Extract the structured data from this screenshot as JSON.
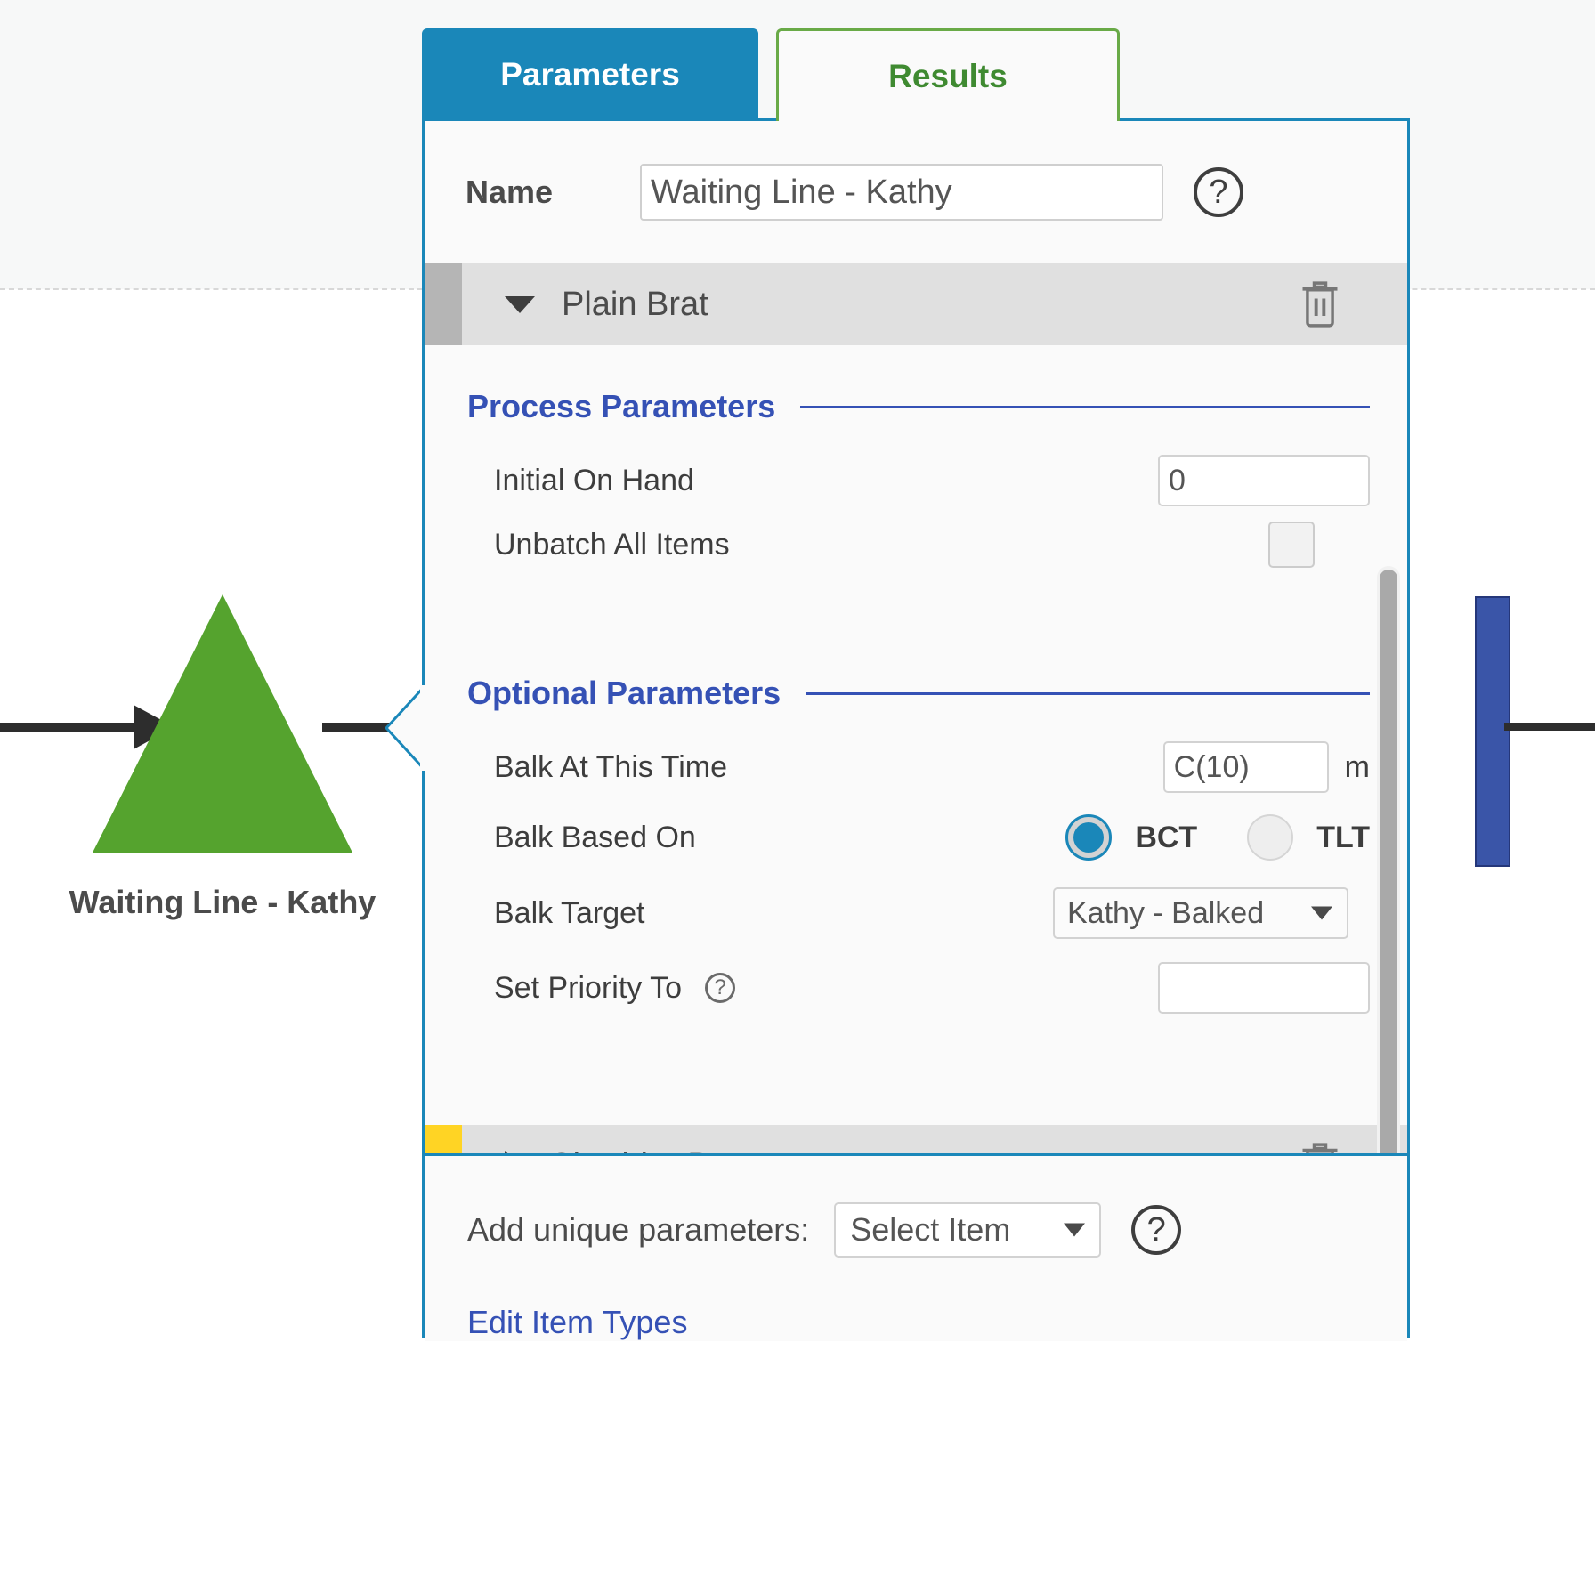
{
  "colors": {
    "tab_active_bg": "#1a87b9",
    "tab_inactive_text": "#69aa47",
    "panel_border": "#1a87b9",
    "section_heading": "#3551b5",
    "queue_shape": "#55a32e",
    "item_swatch_plain": "#b5b5b5",
    "item_swatch_cheddar": "#ffd424",
    "radio_selected": "#1a87b9",
    "link": "#3551b5",
    "downstream_block": "#3a55a8"
  },
  "diagram": {
    "queue_label": "Waiting Line - Kathy",
    "queue_icon": "triangle-queue-shape",
    "inbound_arrow_icon": "flow-arrow-right-icon",
    "outbound_arrow_icon": "flow-connector-line",
    "downstream_block_icon": "resource-block-shape"
  },
  "tabs": [
    {
      "label": "Parameters",
      "active": true
    },
    {
      "label": "Results",
      "active": false
    }
  ],
  "panel": {
    "name_field": {
      "label": "Name",
      "value": "Waiting Line - Kathy",
      "placeholder": "Name",
      "help_icon": "question-mark-circle-icon"
    },
    "items": [
      {
        "title": "Plain Brat",
        "expanded": true,
        "caret_icon": "caret-down-icon",
        "delete_icon": "trash-icon",
        "swatch_color": "#b5b5b5",
        "sections": [
          {
            "title": "Process Parameters",
            "fields": [
              {
                "label": "Initial On Hand",
                "type": "text",
                "value": "0",
                "placeholder": ""
              },
              {
                "label": "Unbatch All Items",
                "type": "checkbox",
                "checked": false
              }
            ]
          },
          {
            "title": "Optional Parameters",
            "fields": [
              {
                "label": "Balk At This Time",
                "type": "text",
                "value": "C(10)",
                "placeholder": "",
                "unit": "m"
              },
              {
                "label": "Balk Based On",
                "type": "radio",
                "options": [
                  {
                    "label": "BCT",
                    "selected": true
                  },
                  {
                    "label": "TLT",
                    "selected": false
                  }
                ]
              },
              {
                "label": "Balk Target",
                "type": "select",
                "value": "Kathy - Balked",
                "caret_icon": "caret-down-icon"
              },
              {
                "label": "Set Priority To",
                "type": "text",
                "value": "",
                "placeholder": "",
                "help_icon": "question-mark-circle-small-icon"
              }
            ]
          }
        ]
      },
      {
        "title": "Cheddar Brat",
        "expanded": false,
        "caret_icon": "caret-right-icon",
        "delete_icon": "trash-icon",
        "swatch_color": "#ffd424",
        "sections": []
      }
    ],
    "footer": {
      "add_params_label": "Add unique parameters:",
      "add_params_value": "Select Item",
      "add_params_caret_icon": "caret-down-icon",
      "add_params_help_icon": "question-mark-circle-icon",
      "edit_link": "Edit Item Types"
    },
    "scrollbar": {
      "name": "item-list-scrollbar"
    }
  }
}
